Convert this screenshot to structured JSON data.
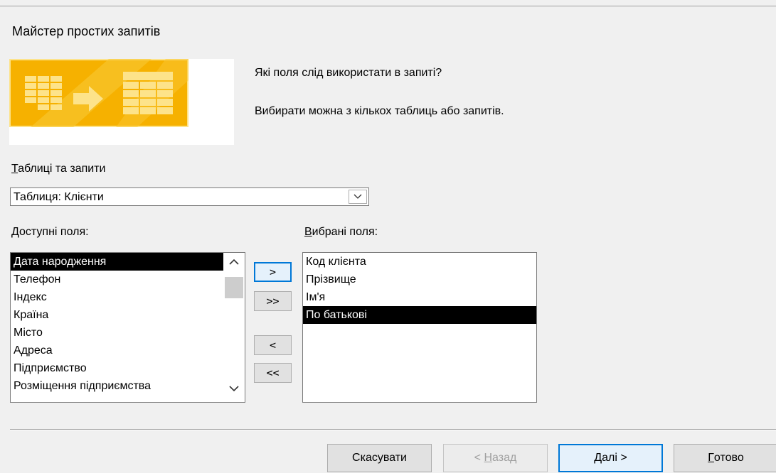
{
  "window": {
    "title": "Майстер простих запитів"
  },
  "prompt": {
    "question": "Які поля слід використати в запиті?",
    "hint": "Вибирати можна з кількох таблиць або запитів."
  },
  "tables": {
    "label_accel": "Т",
    "label_rest": "аблиці та запити",
    "selected": "Таблиця: Клієнти"
  },
  "available_fields": {
    "label_accel": "Д",
    "label_rest": "оступні поля:",
    "items": [
      "Дата народження",
      "Телефон",
      "Індекс",
      "Країна",
      "Місто",
      "Адреса",
      "Підприємство",
      "Розміщення підприємства"
    ],
    "selected_index": 0
  },
  "selected_fields": {
    "label_accel": "В",
    "label_rest": "ибрані поля:",
    "items": [
      "Код клієнта",
      "Прізвище",
      "Ім'я",
      "По батькові"
    ],
    "selected_index": 3
  },
  "move_buttons": {
    "add_one": ">",
    "add_all": ">>",
    "remove_one": "<",
    "remove_all": "<<"
  },
  "footer": {
    "cancel": "Скасувати",
    "back_prefix": "< ",
    "back_accel": "Н",
    "back_rest": "азад",
    "next_accel": "Д",
    "next_rest": "алі >",
    "finish_accel": "Г",
    "finish_rest": "отово"
  },
  "colors": {
    "graphic_orange": "#f6b100",
    "graphic_light": "#fde38a",
    "focus_blue": "#0078d7"
  }
}
